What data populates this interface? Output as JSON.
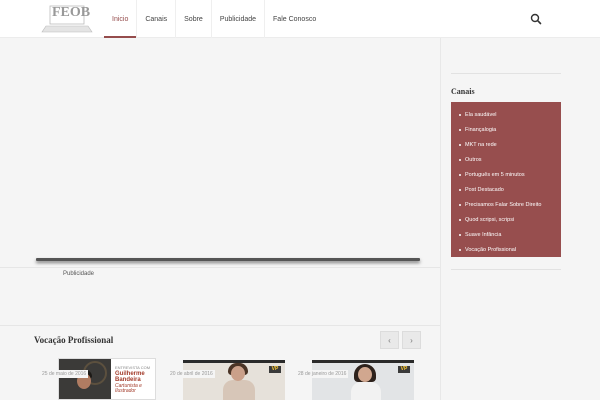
{
  "header": {
    "logo_text": "FEOB",
    "nav": [
      {
        "label": "Inicio",
        "active": true
      },
      {
        "label": "Canais",
        "active": false
      },
      {
        "label": "Sobre",
        "active": false
      },
      {
        "label": "Publicidade",
        "active": false
      },
      {
        "label": "Fale Conosco",
        "active": false
      }
    ],
    "search_icon": "search-icon"
  },
  "main": {
    "ad_label": "Publicidade"
  },
  "sidebar": {
    "title": "Canais",
    "accent_color": "#974e4e",
    "items": [
      "Ela saudável",
      "Finançalogia",
      "MKT na rede",
      "Outros",
      "Português em 5 minutos",
      "Post Destacado",
      "Precisamos Falar Sobre Direito",
      "Quod scripsi, scripsi",
      "Suave Infância",
      "Vocação Profissional"
    ]
  },
  "section": {
    "title": "Vocação Profissional",
    "prev_icon": "chevron-left-icon",
    "next_icon": "chevron-right-icon",
    "prev_label": "‹",
    "next_label": "›",
    "cards": [
      {
        "date": "25 de maio de 2016",
        "thumb_small_text": "ENTREVISTA COM",
        "thumb_name": "Guilherme Bandeira",
        "thumb_role": "Cartunista e Ilustrador"
      },
      {
        "date": "20 de abril de 2016",
        "thumb_logo": "VP"
      },
      {
        "date": "28 de janeiro de 2016",
        "thumb_logo": "VP"
      }
    ]
  }
}
